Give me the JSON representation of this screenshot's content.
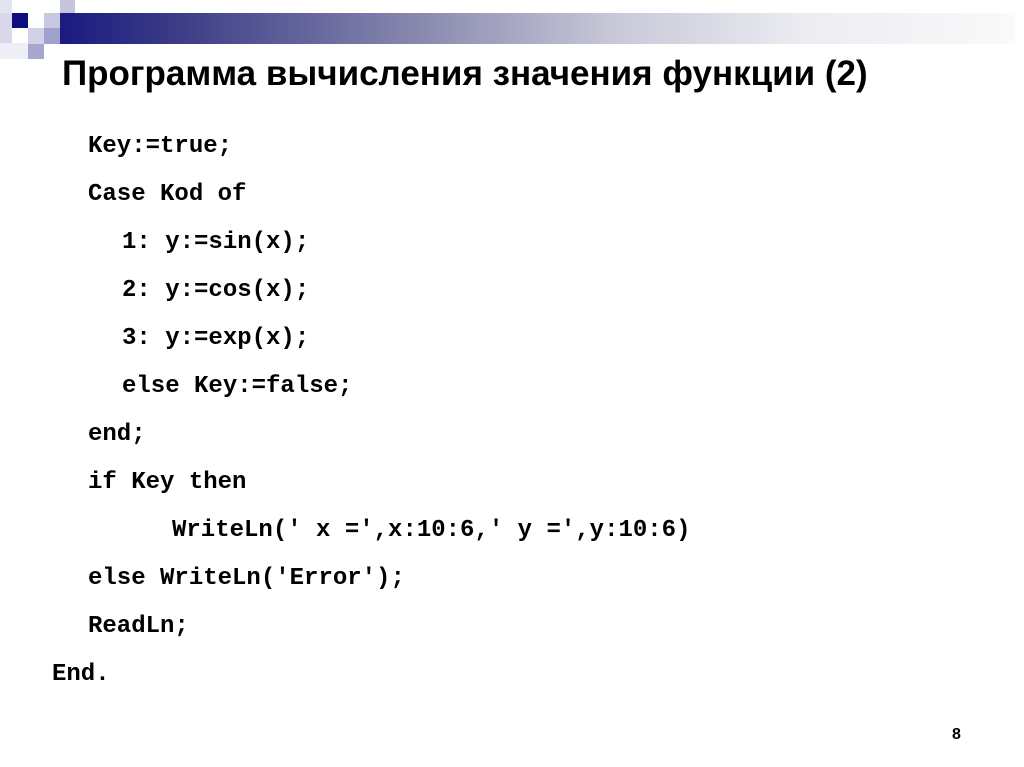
{
  "slide": {
    "title": "Программа вычисления значения функции (2)",
    "page_number": "8",
    "colors": {
      "accent_dark": "#1a1a80",
      "accent_light": "#9a9ac8",
      "text": "#000000",
      "background": "#ffffff"
    },
    "code_lines": [
      {
        "indent": 1,
        "text": "Key:=true;"
      },
      {
        "indent": 1,
        "text": "Case Kod of"
      },
      {
        "indent": 2,
        "text": "1: y:=sin(x);"
      },
      {
        "indent": 2,
        "text": "2: y:=cos(x);"
      },
      {
        "indent": 2,
        "text": "3: y:=exp(x);"
      },
      {
        "indent": 2,
        "text": "else Key:=false;"
      },
      {
        "indent": 1,
        "text": "end;"
      },
      {
        "indent": 1,
        "text": "if Key then"
      },
      {
        "indent": 3,
        "text": "WriteLn(' x =',x:10:6,' y =',y:10:6)"
      },
      {
        "indent": 1,
        "text": "else WriteLn('Error');"
      },
      {
        "indent": 1,
        "text": "ReadLn;"
      },
      {
        "indent": 0,
        "text": "End."
      }
    ]
  }
}
